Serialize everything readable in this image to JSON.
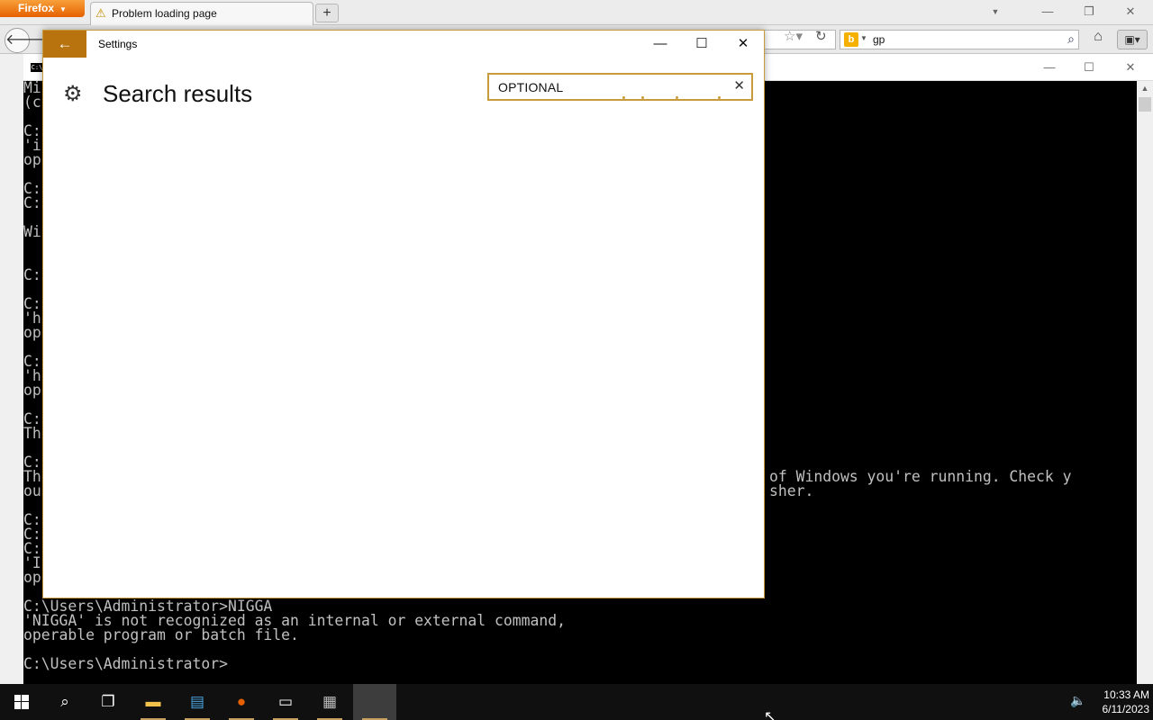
{
  "firefox": {
    "menu_label": "Firefox",
    "tab_title": "Problem loading page",
    "new_tab_label": "+",
    "search_value": "gp",
    "search_engine_letter": "b"
  },
  "cmd": {
    "lines": [
      "Mi",
      "(c",
      "",
      "C:",
      "'i",
      "op",
      "",
      "C:",
      "C:",
      "",
      "Wi",
      "",
      "",
      "C:",
      "",
      "C:",
      "'h",
      "op",
      "",
      "C:",
      "'h",
      "op",
      "",
      "C:",
      "Th",
      "",
      "C:",
      "Th",
      "ou",
      "",
      "C:",
      "C:",
      "C:",
      "'I",
      "op",
      "",
      "C:\\Users\\Administrator>NIGGA",
      "'NIGGA' is not recognized as an internal or external command,",
      "operable program or batch file.",
      "",
      "C:\\Users\\Administrator>"
    ],
    "visible_fragment_1": "of Windows you're running. Check y",
    "visible_fragment_2": "sher."
  },
  "settings": {
    "window_title": "Settings",
    "heading": "Search results",
    "search_value": "OPTIONAL"
  },
  "taskbar": {
    "time": "10:33 AM",
    "date": "6/11/2023"
  },
  "colors": {
    "accent": "#b8720e",
    "firefox_orange": "#e66000",
    "cmd_text": "#c0c0c0"
  }
}
